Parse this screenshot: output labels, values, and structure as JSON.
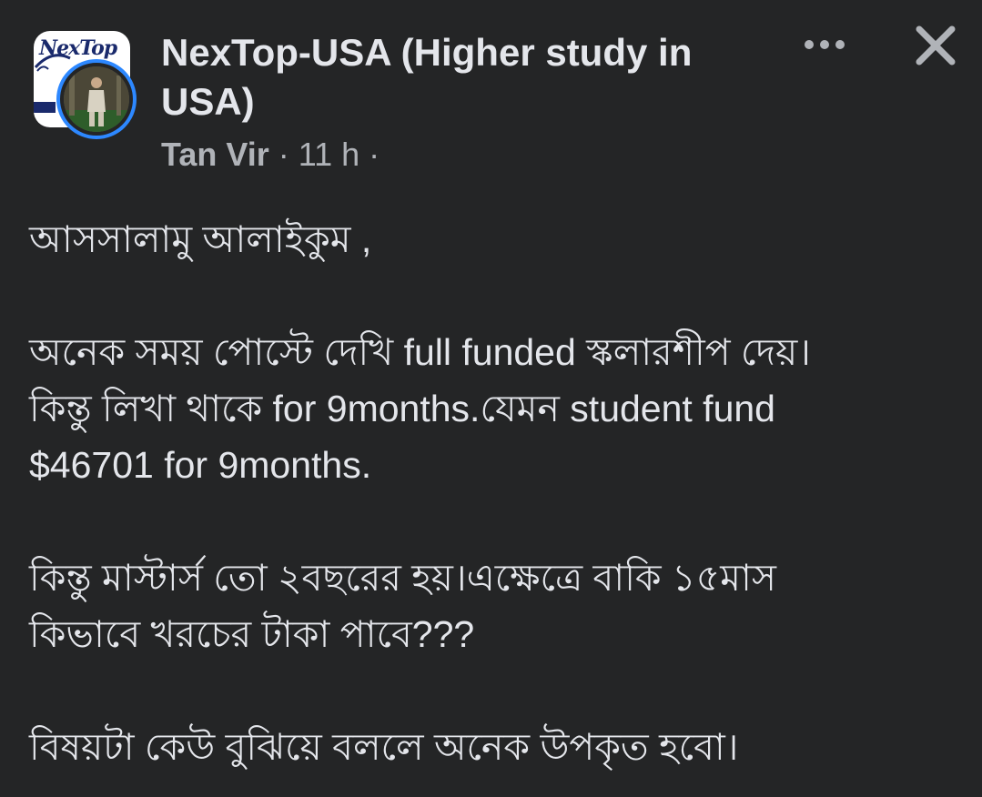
{
  "header": {
    "group_name": "NexTop-USA (Higher study in USA)",
    "group_logo_text": "NexTop",
    "author": "Tan Vir",
    "separator": "·",
    "time": "11 h",
    "more_icon": "more-horizontal-icon",
    "close_icon": "close-icon",
    "accent_color": "#2d88ff"
  },
  "post": {
    "greeting": "আসসালামু আলাইকুম ,",
    "para1": {
      "line1": "অনেক সময় পোস্টে দেখি full funded স্কলারশীপ দেয়।",
      "line2": "কিন্তু লিখা থাকে for 9months.যেমন student fund",
      "line3": "$46701 for 9months."
    },
    "para2": {
      "line1": "কিন্তু মাস্টার্স তো ২বছরের হয়।এক্ষেত্রে বাকি ১৫মাস",
      "line2": "কিভাবে খরচের টাকা পাবে???"
    },
    "para3": "বিষয়টা কেউ বুঝিয়ে বললে অনেক উপকৃত হবো।"
  }
}
